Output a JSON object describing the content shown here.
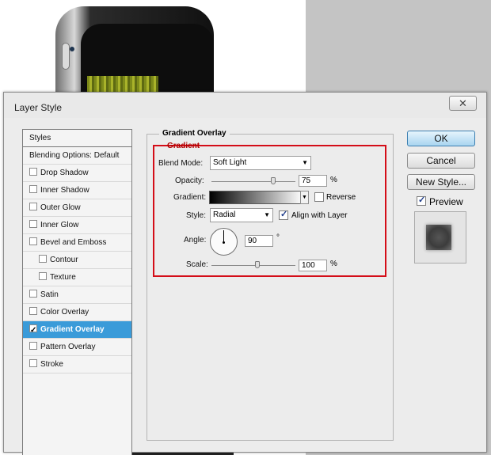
{
  "dialog": {
    "title": "Layer Style",
    "close_icon": "close-x"
  },
  "styles_list": {
    "header": "Styles",
    "items": [
      {
        "label": "Blending Options: Default",
        "checkbox": false,
        "checked": false,
        "indent": false,
        "selected": false
      },
      {
        "label": "Drop Shadow",
        "checkbox": true,
        "checked": false,
        "indent": false,
        "selected": false
      },
      {
        "label": "Inner Shadow",
        "checkbox": true,
        "checked": false,
        "indent": false,
        "selected": false
      },
      {
        "label": "Outer Glow",
        "checkbox": true,
        "checked": false,
        "indent": false,
        "selected": false
      },
      {
        "label": "Inner Glow",
        "checkbox": true,
        "checked": false,
        "indent": false,
        "selected": false
      },
      {
        "label": "Bevel and Emboss",
        "checkbox": true,
        "checked": false,
        "indent": false,
        "selected": false
      },
      {
        "label": "Contour",
        "checkbox": true,
        "checked": false,
        "indent": true,
        "selected": false
      },
      {
        "label": "Texture",
        "checkbox": true,
        "checked": false,
        "indent": true,
        "selected": false
      },
      {
        "label": "Satin",
        "checkbox": true,
        "checked": false,
        "indent": false,
        "selected": false
      },
      {
        "label": "Color Overlay",
        "checkbox": true,
        "checked": false,
        "indent": false,
        "selected": false
      },
      {
        "label": "Gradient Overlay",
        "checkbox": true,
        "checked": true,
        "indent": false,
        "selected": true
      },
      {
        "label": "Pattern Overlay",
        "checkbox": true,
        "checked": false,
        "indent": false,
        "selected": false
      },
      {
        "label": "Stroke",
        "checkbox": true,
        "checked": false,
        "indent": false,
        "selected": false
      }
    ]
  },
  "gradient_overlay": {
    "section_title": "Gradient Overlay",
    "group_title": "Gradient",
    "blend_mode": {
      "label": "Blend Mode:",
      "value": "Soft Light"
    },
    "opacity": {
      "label": "Opacity:",
      "value": "75",
      "unit": "%",
      "level": 0.75
    },
    "gradient": {
      "label": "Gradient:",
      "reverse_label": "Reverse",
      "reverse_checked": false
    },
    "style": {
      "label": "Style:",
      "value": "Radial",
      "align_label": "Align with Layer",
      "align_checked": true
    },
    "angle": {
      "label": "Angle:",
      "value": "90",
      "unit": "°"
    },
    "scale": {
      "label": "Scale:",
      "value": "100",
      "unit": "%",
      "level": 0.55
    }
  },
  "buttons": {
    "ok": "OK",
    "cancel": "Cancel",
    "new_style": "New Style...",
    "preview": "Preview",
    "preview_checked": true
  },
  "colors": {
    "selection": "#3a9bd9",
    "highlight_box": "#d40d18",
    "ok_button": "#a9d5f0"
  }
}
